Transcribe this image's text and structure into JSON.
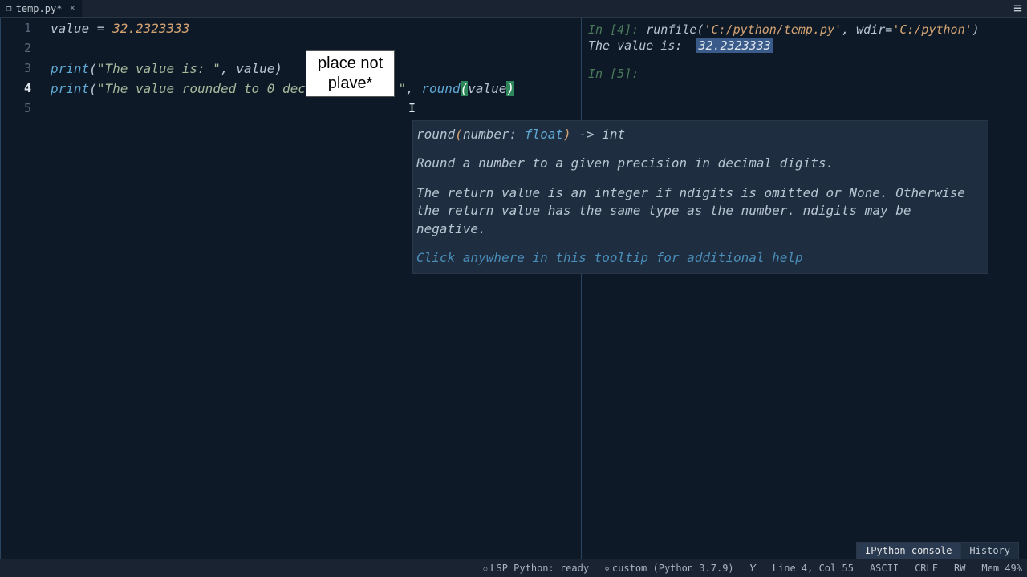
{
  "tab": {
    "filename": "temp.py*",
    "close": "×"
  },
  "code": {
    "line1": {
      "ident": "value",
      "op": " = ",
      "num": "32.2323333"
    },
    "line3": {
      "fn": "print",
      "str": "\"The value is: \"",
      "sep": ", ",
      "arg": "value"
    },
    "line4": {
      "fn": "print",
      "str": "\"The value rounded to 0 decimal plave: \"",
      "sep": ", ",
      "call": "round",
      "arg": "value"
    }
  },
  "lineNums": [
    "1",
    "2",
    "3",
    "4",
    "5"
  ],
  "annotation": {
    "l1": "place not",
    "l2": "plave*"
  },
  "tooltip": {
    "sig_name": "round",
    "sig_param": "number: ",
    "sig_type": "float",
    "sig_ret": " -> int",
    "body1": "Round a number to a given precision in decimal digits.",
    "body2": "The return value is an integer if ndigits is omitted or None. Otherwise the return value has the same type as the number. ndigits may be negative.",
    "link": "Click anywhere in this tooltip for additional help"
  },
  "console": {
    "in4_prompt": "In [4]: ",
    "in4_cmd": "runfile",
    "in4_arg1": "'C:/python/temp.py'",
    "in4_sep": ", wdir=",
    "in4_arg2": "'C:/python'",
    "out_label": "The value is:  ",
    "out_val": "32.2323333",
    "in5_prompt": "In [5]:"
  },
  "consoleTabs": {
    "t1": "IPython console",
    "t2": "History"
  },
  "status": {
    "lsp": "LSP Python: ready",
    "env": "custom (Python 3.7.9)",
    "branch_icon": "𝑌",
    "pos": "Line 4, Col 55",
    "enc": "ASCII",
    "eol": "CRLF",
    "mode": "RW",
    "mem": "Mem 49%"
  }
}
